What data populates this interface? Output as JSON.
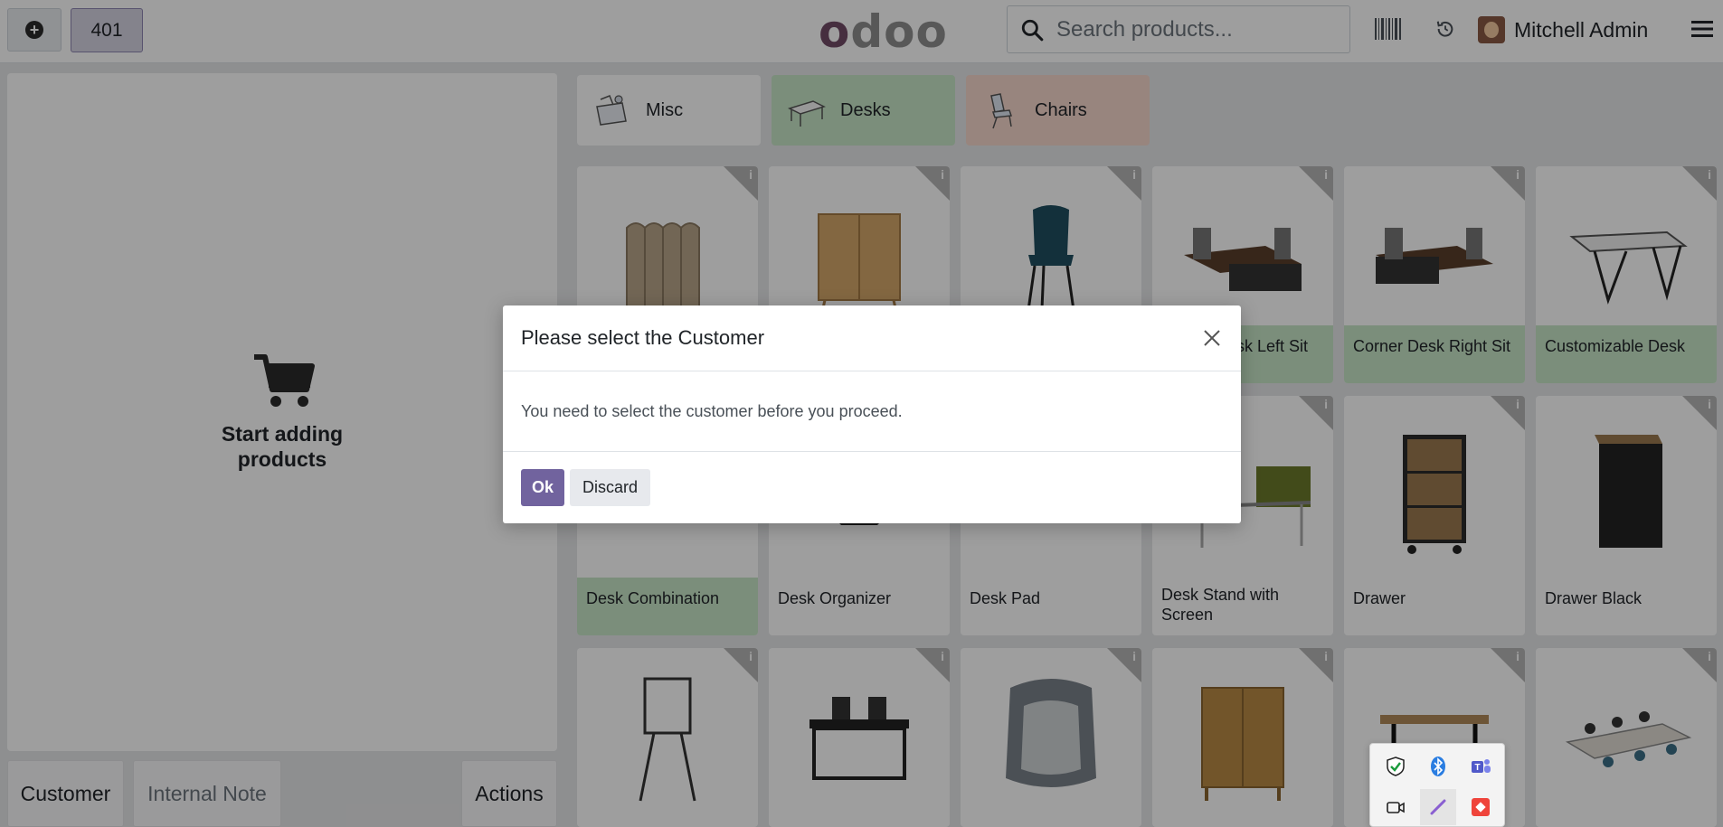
{
  "topbar": {
    "order_number": "401",
    "logo": "odoo",
    "search_placeholder": "Search products...",
    "user_name": "Mitchell Admin"
  },
  "left_pane": {
    "empty_label": "Start adding products",
    "buttons": {
      "customer": "Customer",
      "internal_note": "Internal Note",
      "actions": "Actions"
    }
  },
  "categories": [
    {
      "label": "Misc",
      "icon": "misc-category-icon"
    },
    {
      "label": "Desks",
      "icon": "desk-category-icon"
    },
    {
      "label": "Chairs",
      "icon": "chair-category-icon"
    }
  ],
  "products": {
    "row1": [
      "",
      "",
      "",
      "Corner Desk Left Sit",
      "Corner Desk Right Sit",
      "Customizable Desk"
    ],
    "row2": [
      "Desk Combination",
      "Desk Organizer",
      "Desk Pad",
      "Desk Stand with Screen",
      "Drawer",
      "Drawer Black"
    ],
    "row3": [
      "",
      "",
      "",
      "",
      "",
      ""
    ]
  },
  "modal": {
    "title": "Please select the Customer",
    "body": "You need to select the customer before you proceed.",
    "ok_label": "Ok",
    "discard_label": "Discard"
  },
  "colors": {
    "accent": "#71639e",
    "desks_category": "#c7e6c7",
    "chairs_category": "#f6d7cc",
    "misc_category": "#ffffff"
  }
}
